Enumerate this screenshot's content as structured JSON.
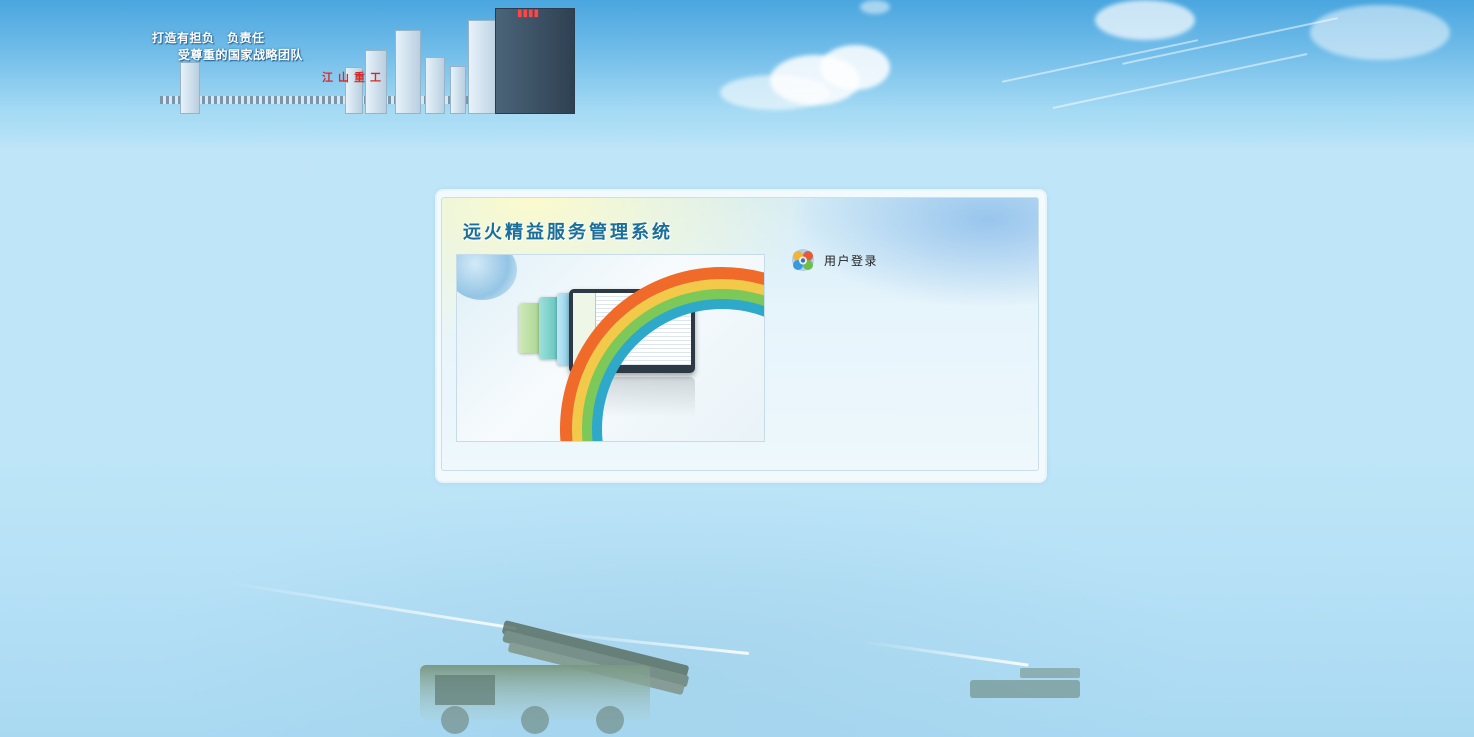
{
  "header": {
    "slogan_line1": "打造有担负　负责任",
    "slogan_line2": "受尊重的国家战略团队",
    "brand_mark": "江山重工"
  },
  "login_panel": {
    "system_title": "远火精益服务管理系统",
    "login_section_label": "用户登录",
    "login_icon": "user-login-icon"
  },
  "colors": {
    "sky_top": "#4aa6df",
    "sky_body": "#bfe6f8",
    "title_blue": "#1a6f9a",
    "panel_bg": "#f3fafe"
  }
}
